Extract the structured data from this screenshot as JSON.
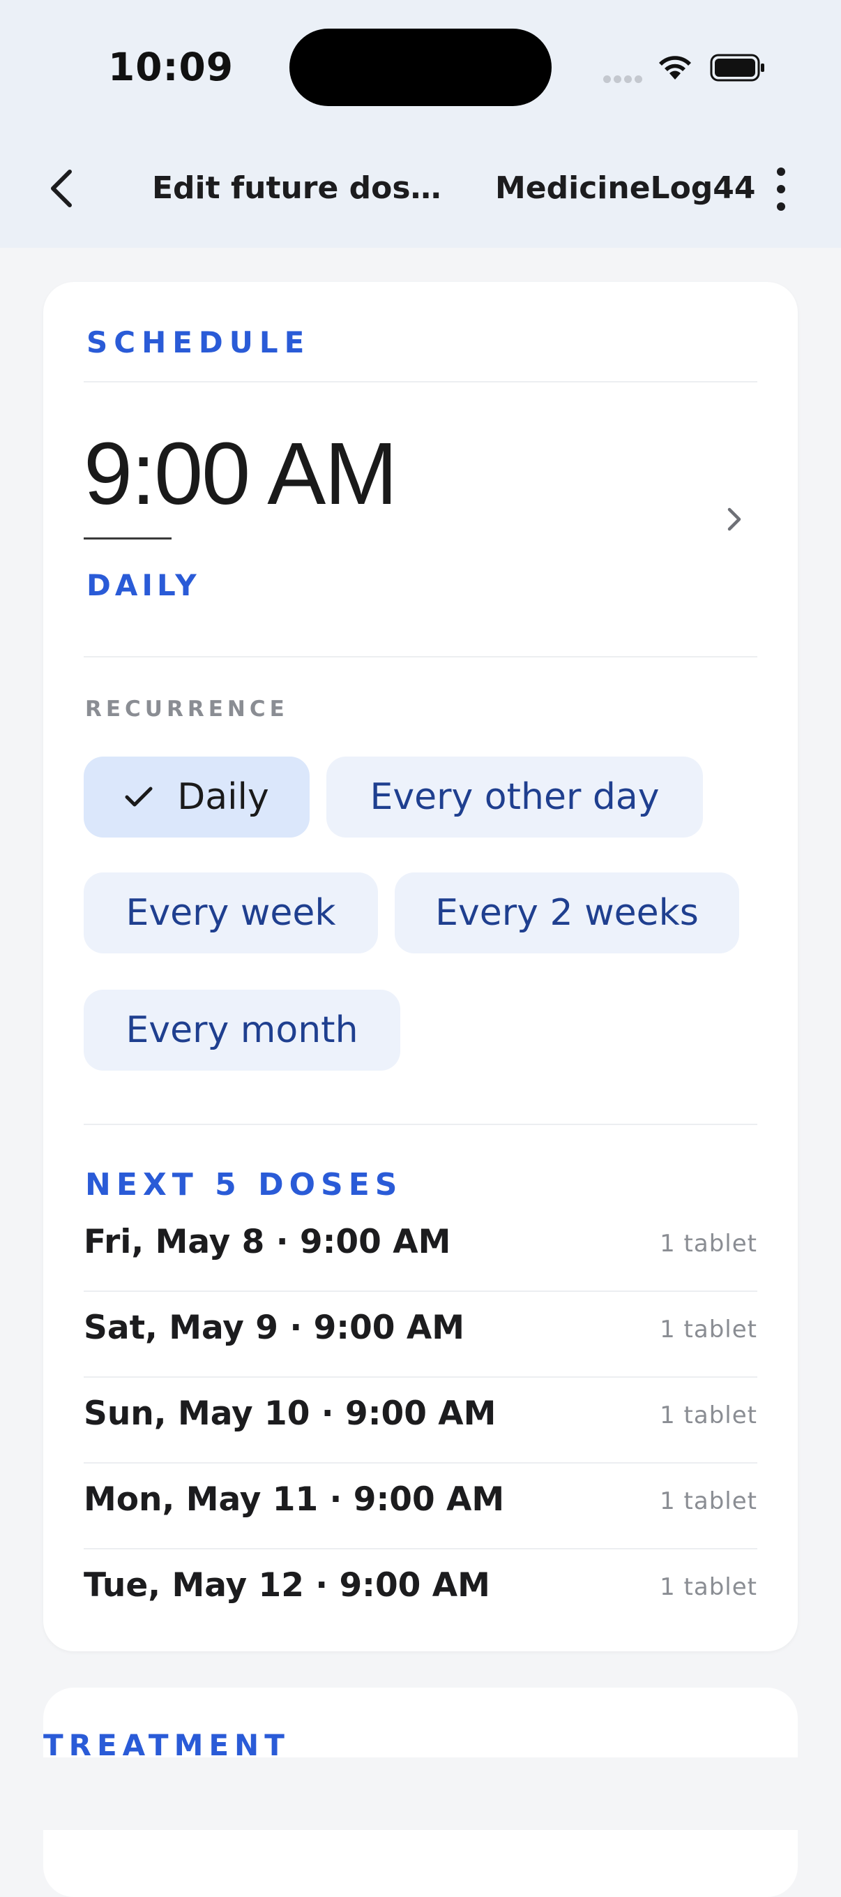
{
  "status_bar": {
    "time": "10:09"
  },
  "app_bar": {
    "title": "Edit future dos…",
    "app_name": "MedicineLog44",
    "back_icon": "chevron-left-icon",
    "more_icon": "more-vertical-icon"
  },
  "schedule": {
    "section_label": "SCHEDULE",
    "time": "9:00 AM",
    "frequency": "DAILY"
  },
  "recurrence": {
    "label": "RECURRENCE",
    "options": [
      {
        "label": "Daily",
        "selected": true
      },
      {
        "label": "Every other day",
        "selected": false
      },
      {
        "label": "Every week",
        "selected": false
      },
      {
        "label": "Every 2 weeks",
        "selected": false
      },
      {
        "label": "Every month",
        "selected": false
      }
    ]
  },
  "next_doses": {
    "label": "NEXT 5 DOSES",
    "items": [
      {
        "date": "Fri, May 8 · 9:00 AM",
        "qty": "1 tablet"
      },
      {
        "date": "Sat, May 9 · 9:00 AM",
        "qty": "1 tablet"
      },
      {
        "date": "Sun, May 10 · 9:00 AM",
        "qty": "1 tablet"
      },
      {
        "date": "Mon, May 11 · 9:00 AM",
        "qty": "1 tablet"
      },
      {
        "date": "Tue, May 12 · 9:00 AM",
        "qty": "1 tablet"
      }
    ]
  },
  "treatment": {
    "section_label": "TREATMENT"
  },
  "colors": {
    "accent": "#2a5bd7",
    "chip_bg": "#edf2fb",
    "chip_selected_bg": "#dbe7fb",
    "header_bg": "#ebf0f7"
  }
}
